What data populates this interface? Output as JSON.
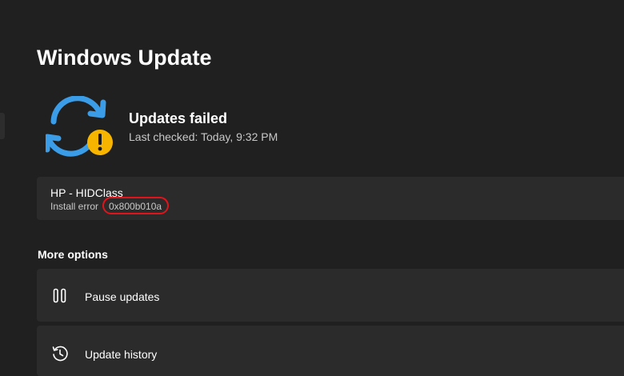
{
  "page": {
    "title": "Windows Update"
  },
  "status": {
    "icon": "sync-warning-icon",
    "title": "Updates failed",
    "last_checked": "Last checked: Today, 9:32 PM"
  },
  "failed_update": {
    "name": "HP - HIDClass",
    "error_label": "Install error",
    "error_code": "0x800b010a",
    "highlight_color": "#e1131b"
  },
  "more_options": {
    "heading": "More options",
    "items": [
      {
        "label": "Pause updates",
        "icon": "pause-icon"
      },
      {
        "label": "Update history",
        "icon": "history-icon"
      }
    ]
  },
  "colors": {
    "background": "#202020",
    "card": "#2b2b2b",
    "accent_blue": "#3b9de8",
    "warning_yellow": "#f7b500"
  }
}
